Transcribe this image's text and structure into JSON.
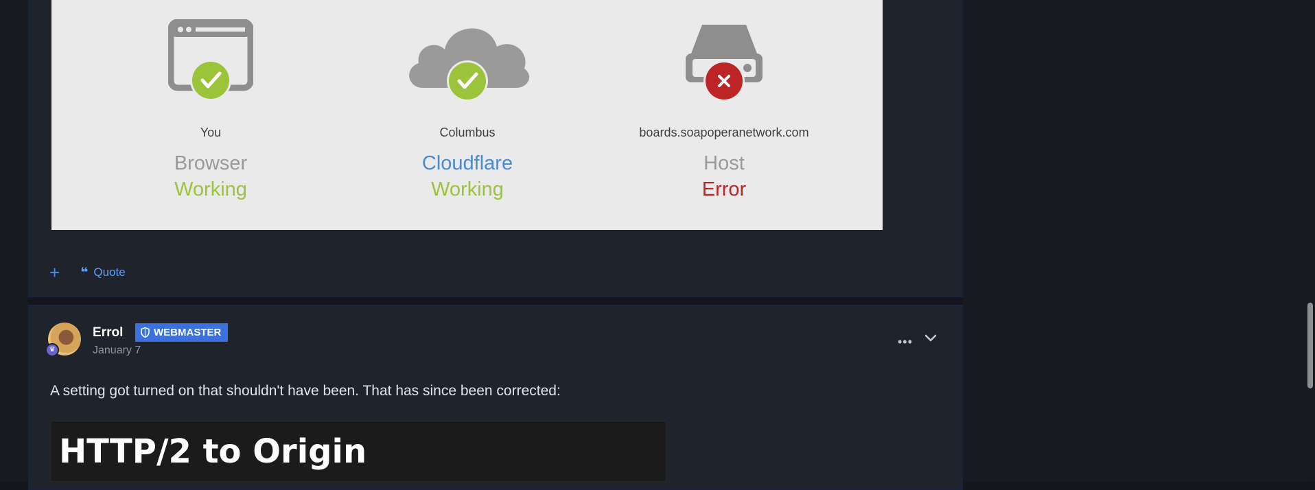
{
  "cloudflare_panel": {
    "columns": [
      {
        "location": "You",
        "name": "Browser",
        "status": "Working",
        "name_color": "#9a9a9a",
        "status_color": "#9bc43b",
        "icon": "browser-check-icon"
      },
      {
        "location": "Columbus",
        "name": "Cloudflare",
        "status": "Working",
        "name_color": "#4a8ad1",
        "status_color": "#9bc43b",
        "icon": "cloud-check-icon"
      },
      {
        "location": "boards.soapoperanetwork.com",
        "name": "Host",
        "status": "Error",
        "name_color": "#9a9a9a",
        "status_color": "#bd2426",
        "icon": "server-error-icon"
      }
    ]
  },
  "post_actions": {
    "plus_label": "+",
    "quote_label": "Quote"
  },
  "post2": {
    "author": "Errol",
    "role_badge": "WEBMASTER",
    "date": "January 7",
    "text": "A setting got turned on that shouldn't have been. That has since been corrected:",
    "image_title": "HTTP/2 to Origin",
    "menu_icons": [
      "ellipsis-icon",
      "chevron-down-icon"
    ]
  },
  "colors": {
    "page_bg": "#13161c",
    "post_bg": "#1f232c",
    "accent": "#3a71df",
    "link": "#5aa0ff"
  }
}
